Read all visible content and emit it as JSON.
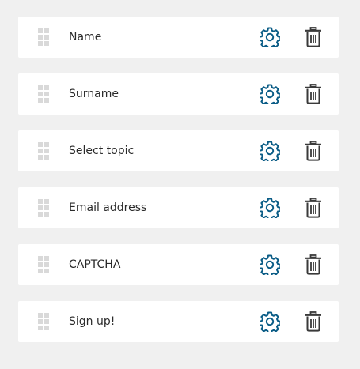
{
  "fields": [
    {
      "label": "Name"
    },
    {
      "label": "Surname"
    },
    {
      "label": "Select topic"
    },
    {
      "label": "Email address"
    },
    {
      "label": "CAPTCHA"
    },
    {
      "label": "Sign up!"
    }
  ],
  "icons": {
    "drag": "drag-handle-icon",
    "settings": "gear-icon",
    "delete": "trash-icon"
  },
  "colors": {
    "background": "#f0f0f0",
    "row_background": "#ffffff",
    "settings_icon": "#0a5c86",
    "delete_icon": "#3a3a3a",
    "drag_handle": "#d9d9d9",
    "label_text": "#2a2a2a"
  }
}
